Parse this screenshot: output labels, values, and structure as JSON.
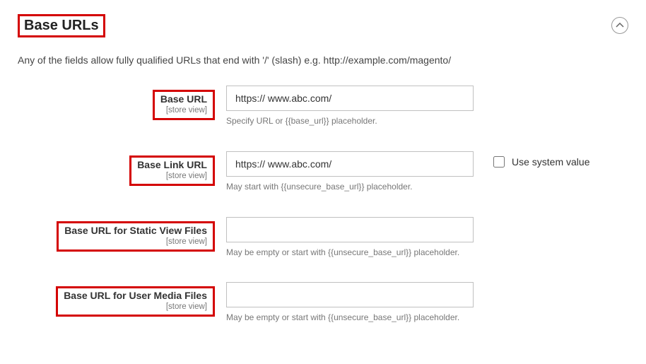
{
  "section": {
    "title": "Base URLs",
    "description": "Any of the fields allow fully qualified URLs that end with '/' (slash) e.g. http://example.com/magento/"
  },
  "fields": {
    "base_url": {
      "label": "Base URL",
      "scope": "[store view]",
      "value": "https:// www.abc.com/",
      "hint": "Specify URL or {{base_url}} placeholder."
    },
    "base_link_url": {
      "label": "Base Link URL",
      "scope": "[store view]",
      "value": "https:// www.abc.com/",
      "hint": "May start with {{unsecure_base_url}} placeholder.",
      "use_system_label": "Use system value"
    },
    "base_static_url": {
      "label": "Base URL for Static View Files",
      "scope": "[store view]",
      "value": "",
      "hint": "May be empty or start with {{unsecure_base_url}} placeholder."
    },
    "base_media_url": {
      "label": "Base URL for User Media Files",
      "scope": "[store view]",
      "value": "",
      "hint": "May be empty or start with {{unsecure_base_url}} placeholder."
    }
  }
}
